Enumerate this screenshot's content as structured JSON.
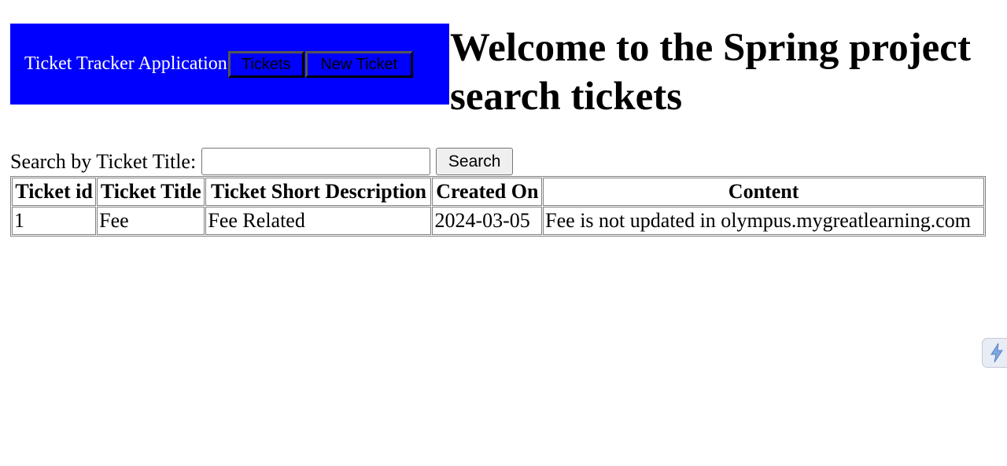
{
  "navbar": {
    "title": "Ticket Tracker Application",
    "tickets_button": "Tickets",
    "new_ticket_button": "New Ticket",
    "background": "#0000ff"
  },
  "heading": {
    "line1": "Welcome to the Spring project",
    "line2": "search tickets"
  },
  "search": {
    "label": "Search by Ticket Title:",
    "value": "",
    "button": "Search"
  },
  "table": {
    "headers": [
      "Ticket id",
      "Ticket Title",
      "Ticket Short Description",
      "Created On",
      "Content"
    ],
    "rows": [
      [
        "1",
        "Fee",
        "Fee Related",
        "2024-03-05",
        "Fee is not updated in olympus.mygreatlearning.com"
      ]
    ]
  },
  "icons": {
    "side_tab": "lightning-bolt-icon"
  }
}
